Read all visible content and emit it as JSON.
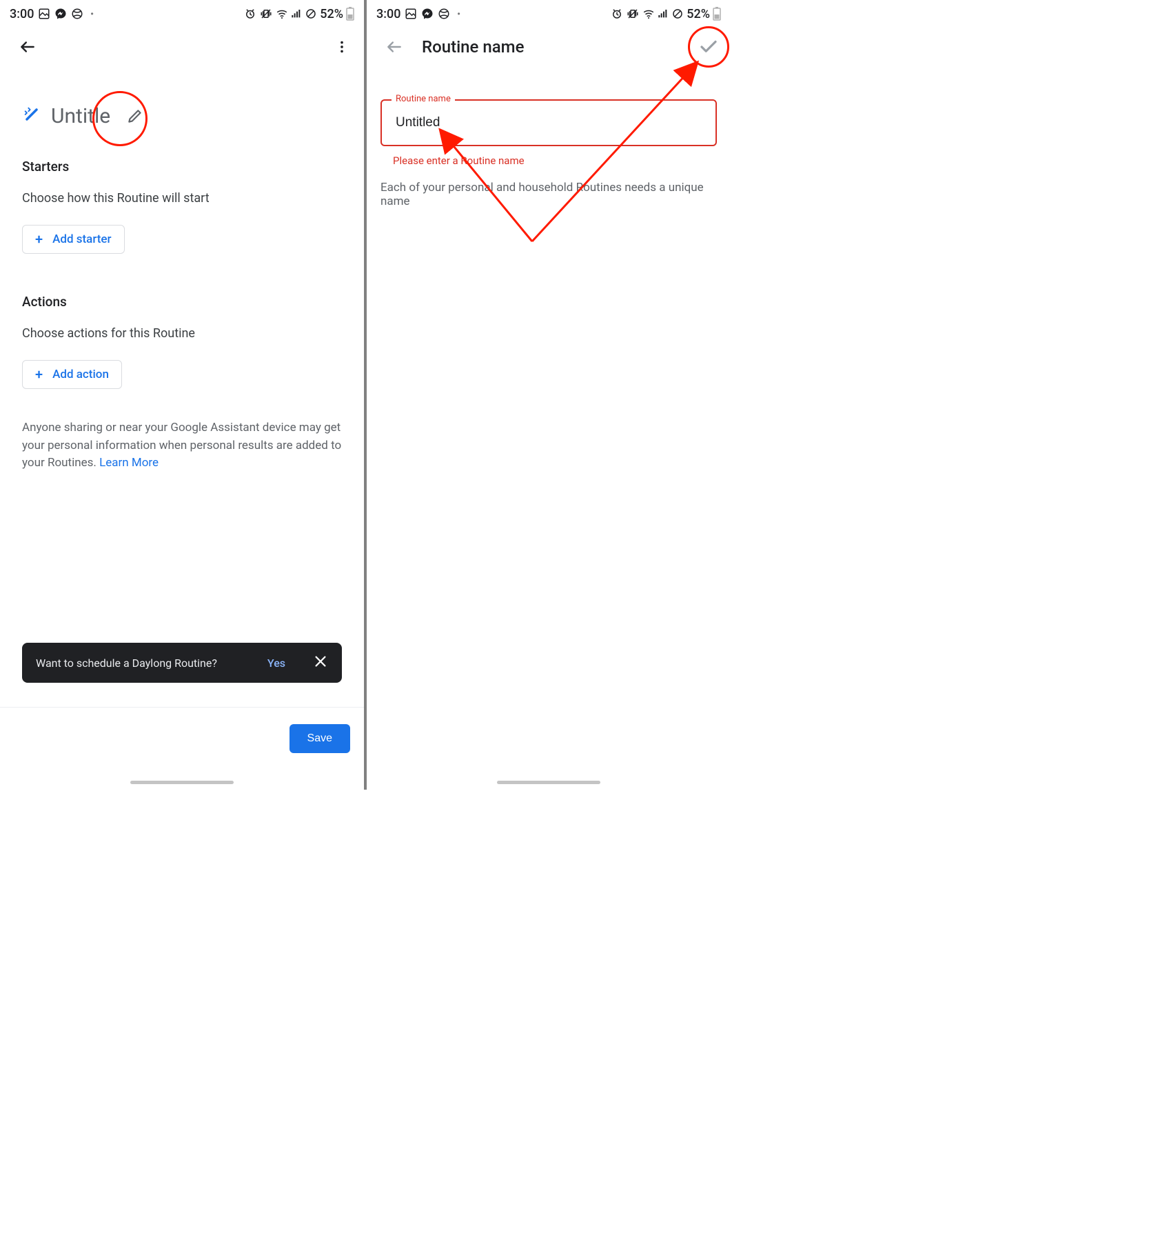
{
  "status": {
    "time": "3:00",
    "battery": "52%"
  },
  "screen1": {
    "routine_title": "Untitle",
    "starters_heading": "Starters",
    "starters_desc": "Choose how this Routine will start",
    "add_starter_label": "Add starter",
    "actions_heading": "Actions",
    "actions_desc": "Choose actions for this Routine",
    "add_action_label": "Add action",
    "info_text": "Anyone sharing or near your Google Assistant device may get your personal information when personal results are added to your Routines. ",
    "learn_more": "Learn More",
    "toast_text": "Want to schedule a Daylong Routine?",
    "toast_yes": "Yes",
    "save_label": "Save"
  },
  "screen2": {
    "appbar_title": "Routine name",
    "field_label": "Routine name",
    "field_value": "Untitled",
    "field_error": "Please enter a Routine name",
    "hint": "Each of your personal and household Routines needs a unique name"
  }
}
